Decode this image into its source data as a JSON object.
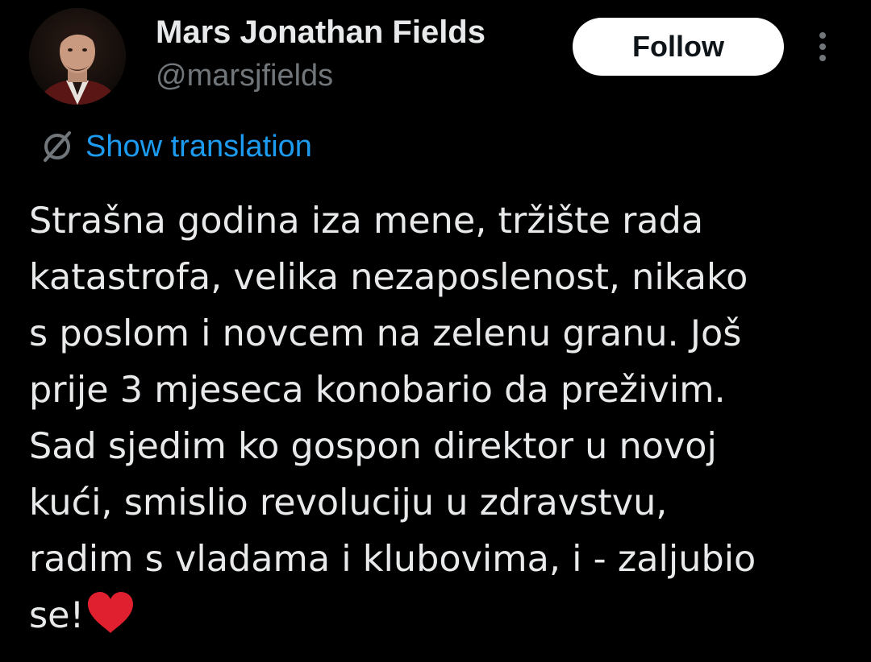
{
  "author": {
    "display_name": "Mars Jonathan Fields",
    "handle": "@marsjfields",
    "avatar_icon": "user-avatar"
  },
  "actions": {
    "follow_label": "Follow",
    "more_icon": "more-vertical-icon"
  },
  "translation": {
    "label": "Show translation",
    "icon": "globe-icon"
  },
  "tweet": {
    "lines": [
      "Strašna godina iza mene, tržište rada",
      "katastrofa, velika nezaposlenost, nikako",
      "s poslom i novcem na zelenu granu. Još",
      "prije 3 mjeseca konobario da preživim.",
      "Sad sjedim ko gospon direktor u novoj",
      "kući, smislio revoluciju u zdravstvu,",
      "radim s vladama i klubovima, i - zaljubio",
      "se!"
    ],
    "emoji": "red-heart-icon"
  },
  "colors": {
    "background": "#000000",
    "text_primary": "#e7e9ea",
    "text_secondary": "#71767b",
    "link": "#1d9bf0",
    "button_bg": "#ffffff",
    "heart": "#e0202e"
  }
}
